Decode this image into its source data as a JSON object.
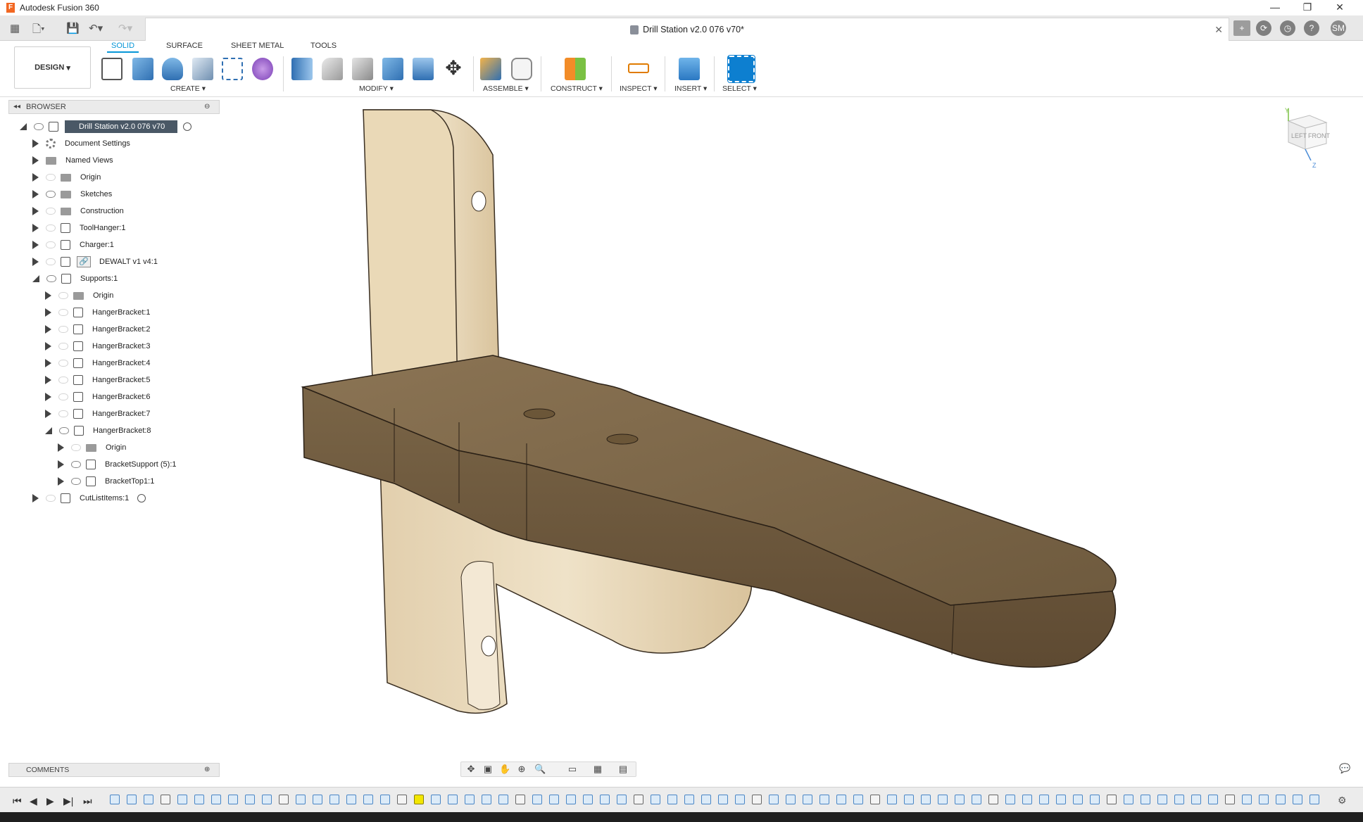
{
  "window": {
    "title": "Autodesk Fusion 360",
    "app_icon": "F"
  },
  "document_tab": {
    "title": "Drill Station v2.0 076 v70*"
  },
  "user": {
    "initials": "SM"
  },
  "workspace": {
    "label": "DESIGN"
  },
  "ribbon": {
    "tabs": [
      "SOLID",
      "SURFACE",
      "SHEET METAL",
      "TOOLS"
    ],
    "active_tab": "SOLID",
    "groups": [
      "CREATE",
      "MODIFY",
      "ASSEMBLE",
      "CONSTRUCT",
      "INSPECT",
      "INSERT",
      "SELECT"
    ]
  },
  "browser": {
    "header": "BROWSER",
    "items": [
      {
        "label": "Drill Station v2.0 076 v70",
        "selected": true
      },
      {
        "label": "Document Settings"
      },
      {
        "label": "Named Views"
      },
      {
        "label": "Origin"
      },
      {
        "label": "Sketches"
      },
      {
        "label": "Construction"
      },
      {
        "label": "ToolHanger:1"
      },
      {
        "label": "Charger:1"
      },
      {
        "label": "DEWALT v1 v4:1"
      },
      {
        "label": "Supports:1"
      },
      {
        "label": "Origin"
      },
      {
        "label": "HangerBracket:1"
      },
      {
        "label": "HangerBracket:2"
      },
      {
        "label": "HangerBracket:3"
      },
      {
        "label": "HangerBracket:4"
      },
      {
        "label": "HangerBracket:5"
      },
      {
        "label": "HangerBracket:6"
      },
      {
        "label": "HangerBracket:7"
      },
      {
        "label": "HangerBracket:8"
      },
      {
        "label": "Origin"
      },
      {
        "label": "BracketSupport (5):1"
      },
      {
        "label": "BracketTop1:1"
      },
      {
        "label": "CutListItems:1"
      }
    ]
  },
  "comments": {
    "label": "COMMENTS"
  },
  "viewcube": {
    "left": "LEFT",
    "front": "FRONT",
    "axis_y": "Y",
    "axis_z": "Z"
  }
}
